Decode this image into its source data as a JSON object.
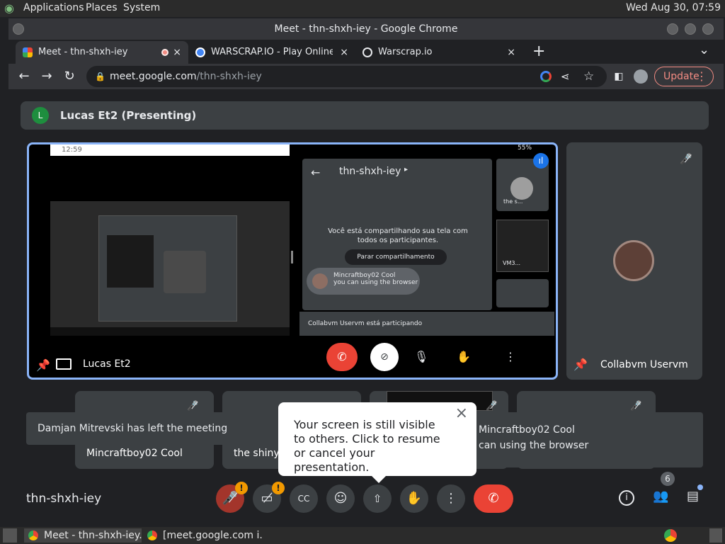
{
  "top_panel": {
    "menus": [
      "Applications",
      "Places",
      "System"
    ],
    "clock": "Wed Aug 30, 07:59"
  },
  "chrome": {
    "window_title": "Meet - thn-shxh-iey - Google Chrome",
    "tabs": [
      {
        "label": "Meet - thn-shxh-iey",
        "close": "×"
      },
      {
        "label": "WARSCRAP.IO    - Play Online",
        "close": "×"
      },
      {
        "label": "Warscrap.io",
        "close": "×"
      }
    ],
    "new_tab": "+",
    "tab_menu": "⌄",
    "address": {
      "host": "meet.google.com",
      "path": "/thn-shxh-iey"
    },
    "update_label": "Update"
  },
  "meet": {
    "presenting_label": "Lucas Et2 (Presenting)",
    "presenting_avatar": "L",
    "main_tile_name": "Lucas Et2",
    "side_tile_name": "Collabvm Uservm",
    "meeting_code": "thn-shxh-iey",
    "participant_count": "6"
  },
  "shared_screen": {
    "status_time": "12:59",
    "battery": "55%",
    "meeting_code": "thn-shxh-iey",
    "sharing_message": "Você está compartilhando sua tela com todos os participantes.",
    "stop_sharing": "Parar compartilhamento",
    "chat_author": "Mincraftboy02 Cool",
    "chat_message": "you can using the browser",
    "join_notice": "Collabvm Uservm está participando",
    "thumb_label_1": "the s...",
    "thumb_label_2": "VM3..."
  },
  "small_tiles": [
    {
      "name": "Mincraftboy02 Cool"
    },
    {
      "name": "the shiny"
    },
    {
      "name": ""
    },
    {
      "name": ""
    }
  ],
  "notifications": {
    "left_message": "Damjan Mitrevski has left the meeting",
    "right_author": "Mincraftboy02 Cool",
    "right_message": "can using the browser"
  },
  "popup": {
    "text": "Your screen is still visible to others. Click to resume or cancel your presentation.",
    "close": "×"
  },
  "taskbar": {
    "items": [
      "Meet - thn-shxh-iey....",
      "[meet.google.com i..."
    ]
  },
  "colors": {
    "accent_blue": "#8ab4f8",
    "end_call_red": "#ea4335",
    "warning_orange": "#f29900"
  }
}
